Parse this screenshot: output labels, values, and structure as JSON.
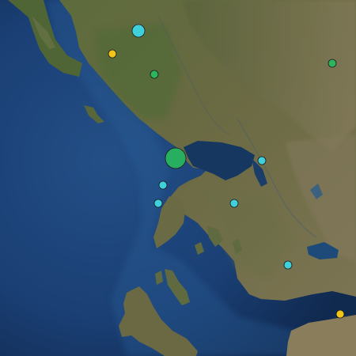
{
  "map": {
    "view": "satellite",
    "colors": {
      "sea_deep": "#0f2a52",
      "sea": "#1b4a86",
      "sea_shallow": "#2a6aa0",
      "land_dark": "#3f4b2c",
      "land": "#5a6a3c",
      "land_light": "#8a8458",
      "mountain": "#7a6e55"
    }
  },
  "markers": [
    {
      "id": "m1",
      "category": "cyan",
      "size": "medium",
      "color": "#3fd0dc"
    },
    {
      "id": "m2",
      "category": "yellow",
      "size": "small",
      "color": "#f0c419"
    },
    {
      "id": "m3",
      "category": "green",
      "size": "small",
      "color": "#2db55d"
    },
    {
      "id": "m4",
      "category": "green",
      "size": "small",
      "color": "#2db55d"
    },
    {
      "id": "m5",
      "category": "green",
      "size": "large",
      "color": "#27ae60"
    },
    {
      "id": "m6",
      "category": "cyan",
      "size": "small",
      "color": "#3fd0dc"
    },
    {
      "id": "m7",
      "category": "cyan",
      "size": "small",
      "color": "#3fd0dc"
    },
    {
      "id": "m8",
      "category": "cyan",
      "size": "small",
      "color": "#3fd0dc"
    },
    {
      "id": "m9",
      "category": "cyan",
      "size": "small",
      "color": "#3fd0dc"
    },
    {
      "id": "m10",
      "category": "cyan",
      "size": "small",
      "color": "#3fd0dc"
    },
    {
      "id": "m11",
      "category": "yellow",
      "size": "small",
      "color": "#f0c419"
    }
  ]
}
